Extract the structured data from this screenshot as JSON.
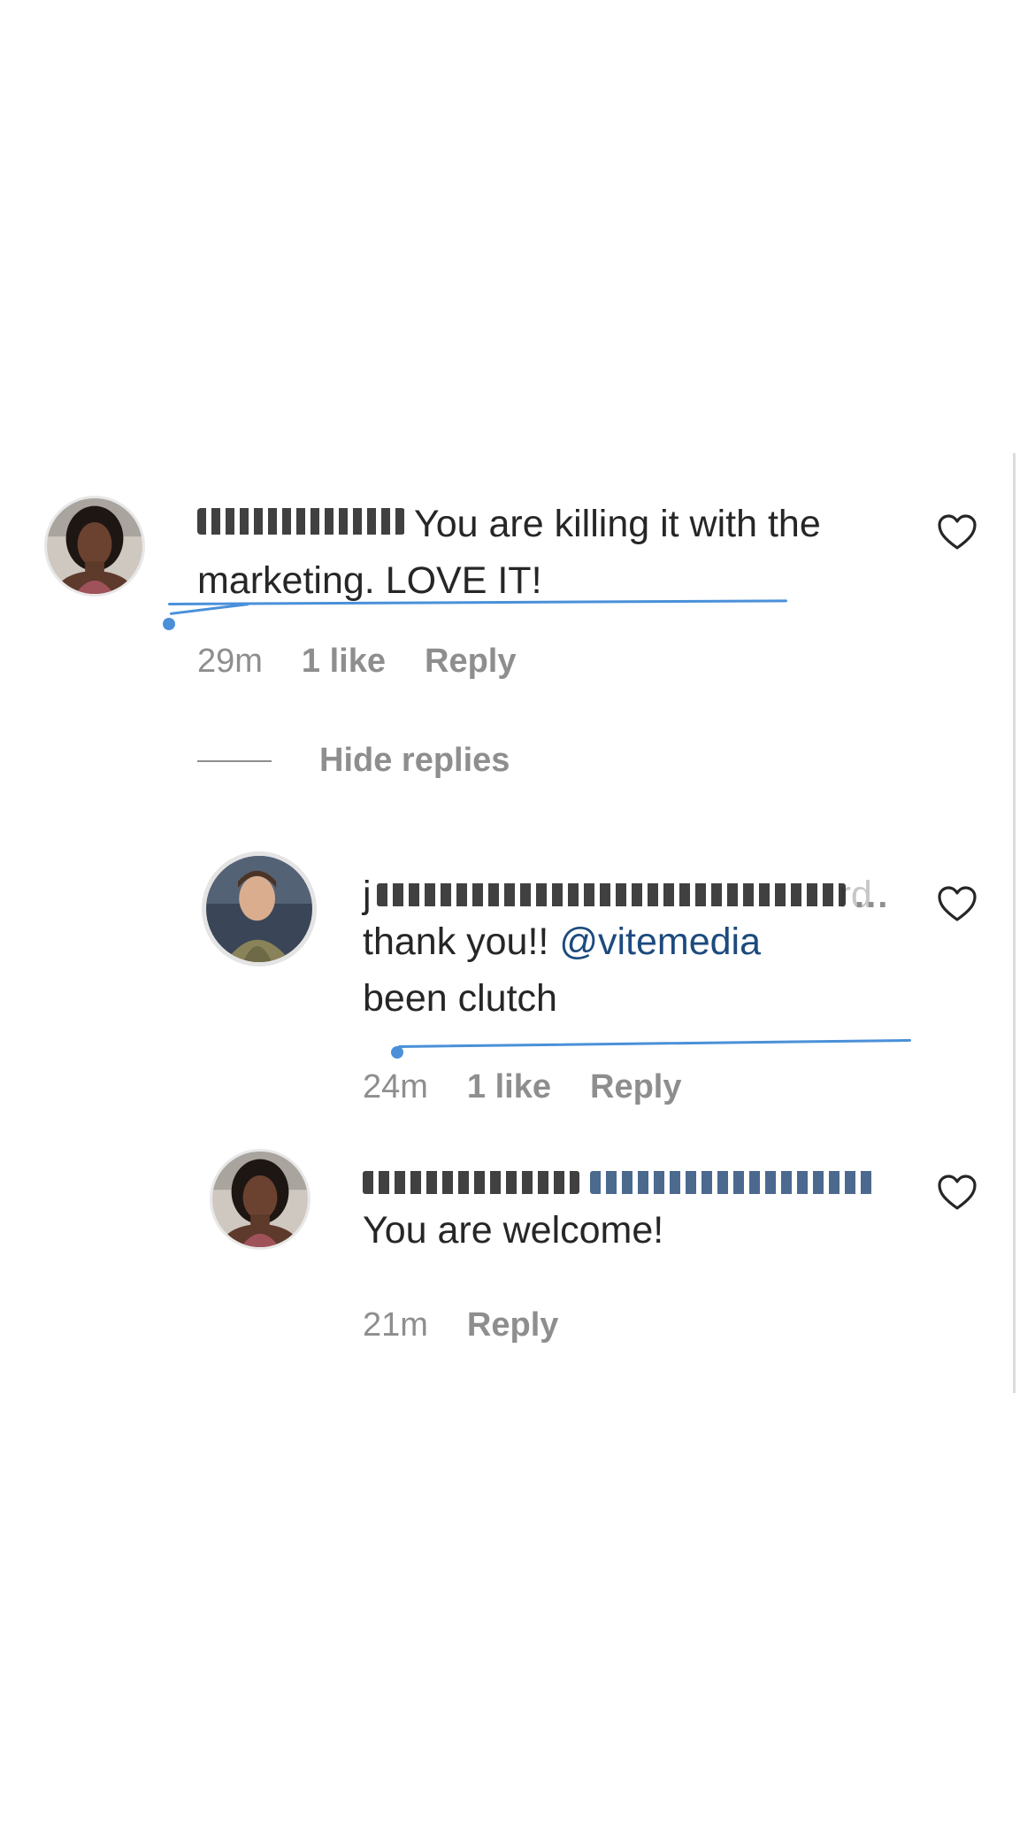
{
  "comments": [
    {
      "username": "",
      "text": "You are killing it with the marketing. LOVE IT!",
      "time": "29m",
      "likes": "1 like",
      "reply_label": "Reply"
    }
  ],
  "thread": {
    "hide_replies_label": "Hide replies",
    "replies": [
      {
        "username_fragment": "j",
        "username_tail": "rd",
        "text_prefix": "thank you!! ",
        "mention": "@vitemedia",
        "text_suffix": "been clutch",
        "time": "24m",
        "likes": "1 like",
        "reply_label": "Reply",
        "more_label": "..."
      },
      {
        "text": "You are welcome!",
        "time": "21m",
        "reply_label": "Reply"
      }
    ]
  },
  "colors": {
    "text": "#262626",
    "secondary": "#8e8e8e",
    "mention": "#1c4a7e",
    "annotation": "#4a90d9"
  },
  "icons": [
    "heart-outline-icon",
    "more-options-icon"
  ]
}
